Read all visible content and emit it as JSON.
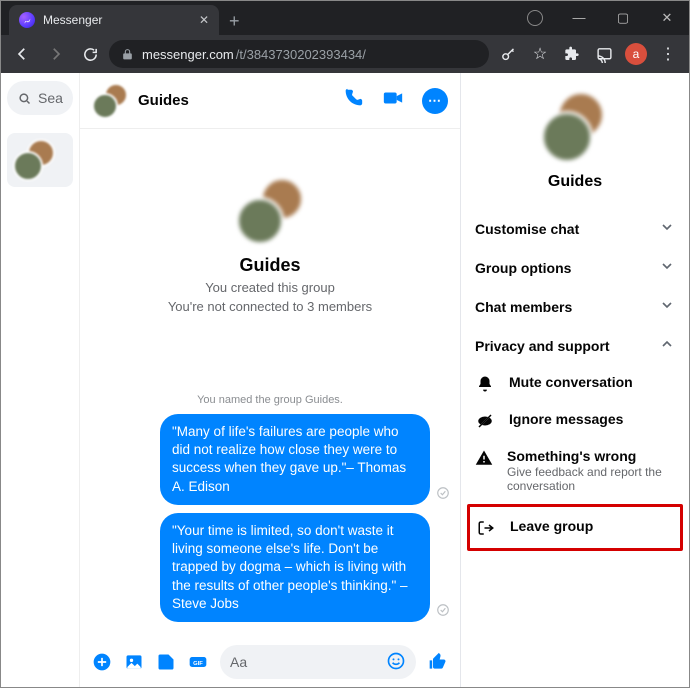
{
  "browser": {
    "tab_title": "Messenger",
    "url_host": "messenger.com",
    "url_path": "/t/3843730202393434/",
    "avatar_letter": "a"
  },
  "sidebar": {
    "search_placeholder": "Sea"
  },
  "conversation": {
    "title": "Guides",
    "big_title": "Guides",
    "created_text": "You created this group",
    "connected_text": "You're not connected to 3 members",
    "system_msg": "You named the group Guides.",
    "messages": [
      "\"Many of life's failures are people who did not realize how close they were to success when they gave up.\"– Thomas A. Edison",
      "\"Your time is limited, so don't waste it living someone else's life. Don't be trapped by dogma – which is living with the results of other people's thinking.\" – Steve Jobs"
    ],
    "composer_placeholder": "Aa"
  },
  "panel": {
    "title": "Guides",
    "sections": {
      "customise": "Customise chat",
      "group_options": "Group options",
      "members": "Chat members",
      "privacy": "Privacy and support"
    },
    "actions": {
      "mute": "Mute conversation",
      "ignore": "Ignore messages",
      "wrong": "Something's wrong",
      "wrong_sub": "Give feedback and report the conversation",
      "leave": "Leave group"
    }
  }
}
